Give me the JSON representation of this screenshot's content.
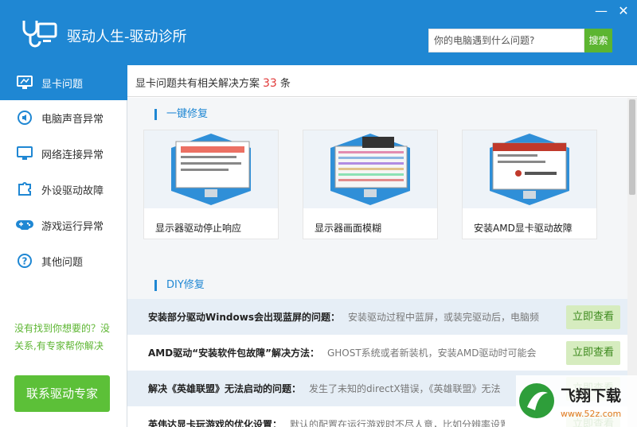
{
  "app": {
    "title": "驱动人生-驱动诊所",
    "minimize": "—",
    "close": "✕"
  },
  "search": {
    "placeholder": "你的电脑遇到什么问题?",
    "button": "搜索"
  },
  "sidebar": {
    "items": [
      {
        "label": "显卡问题",
        "icon": "display-card-icon",
        "active": true
      },
      {
        "label": "电脑声音异常",
        "icon": "speaker-icon"
      },
      {
        "label": "网络连接异常",
        "icon": "monitor-network-icon"
      },
      {
        "label": "外设驱动故障",
        "icon": "puzzle-icon"
      },
      {
        "label": "游戏运行异常",
        "icon": "gamepad-icon"
      },
      {
        "label": "其他问题",
        "icon": "question-icon"
      }
    ],
    "help": "没有找到你想要的？没关系,有专家帮你解决",
    "contact": "联系驱动专家"
  },
  "summary": {
    "prefix": "显卡问题共有相关解决方案",
    "count": "33",
    "suffix": "条"
  },
  "quickfix": {
    "title": "一键修复",
    "cards": [
      {
        "caption": "显示器驱动停止响应"
      },
      {
        "caption": "显示器画面模糊"
      },
      {
        "caption": "安装AMD显卡驱动故障"
      }
    ]
  },
  "diy": {
    "title": "DIY修复",
    "view_label": "立即查看",
    "rows": [
      {
        "title": "安装部分驱动Windows会出现蓝屏的问题：",
        "desc": "安装驱动过程中蓝屏，或装完驱动后，电脑频"
      },
      {
        "title": "AMD驱动“安装软件包故障”解决方法：",
        "desc": "GHOST系统或者新装机，安装AMD驱动时可能会"
      },
      {
        "title": "解决《英雄联盟》无法启动的问题：",
        "desc": "发生了未知的directX错误，《英雄联盟》无法"
      },
      {
        "title": "英伟达显卡玩游戏的优化设置：",
        "desc": "默认的配置在运行游戏时不尽人意，比如分辨率设置不到位"
      }
    ]
  },
  "watermark": {
    "text": "飞翔下载",
    "url": "www.52z.com"
  },
  "colors": {
    "brand": "#1f87d3",
    "green": "#5cb531",
    "count_red": "#e13a3a"
  }
}
